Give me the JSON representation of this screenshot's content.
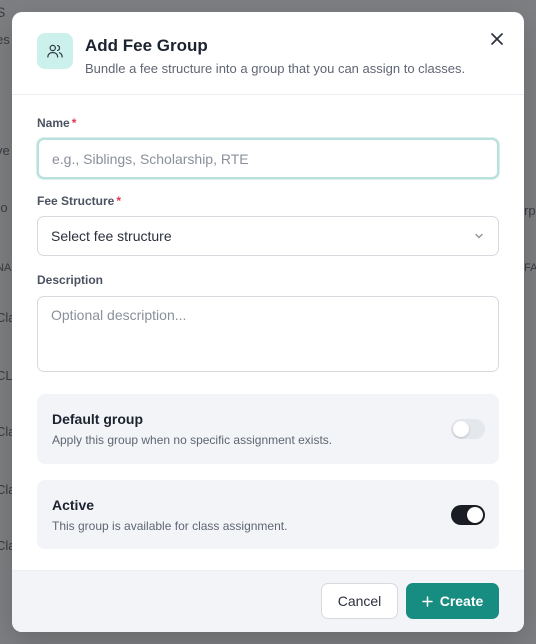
{
  "background": {
    "fragments": [
      "S",
      "es",
      "ve",
      "ro",
      "NA",
      "Cla",
      "CL",
      "Cla",
      "Cla",
      "Cla",
      "rpe",
      "FA"
    ]
  },
  "dialog": {
    "title": "Add Fee Group",
    "subtitle": "Bundle a fee structure into a group that you can assign to classes.",
    "header_icon": "users-icon",
    "close_icon": "close-icon"
  },
  "form": {
    "name": {
      "label": "Name",
      "required_mark": "*",
      "placeholder": "e.g., Siblings, Scholarship, RTE",
      "value": ""
    },
    "fee_structure": {
      "label": "Fee Structure",
      "required_mark": "*",
      "selected": "Select fee structure"
    },
    "description": {
      "label": "Description",
      "placeholder": "Optional description..."
    },
    "default_group": {
      "title": "Default group",
      "description": "Apply this group when no specific assignment exists.",
      "enabled": false
    },
    "active": {
      "title": "Active",
      "description": "This group is available for class assignment.",
      "enabled": true
    }
  },
  "footer": {
    "cancel_label": "Cancel",
    "create_label": "Create",
    "create_icon": "plus-icon"
  },
  "colors": {
    "accent": "#178c80",
    "icon_bg": "#ccf1ec",
    "required": "#e0384b",
    "switch_on": "#1a1d23",
    "switch_off": "#e4e7eb"
  }
}
